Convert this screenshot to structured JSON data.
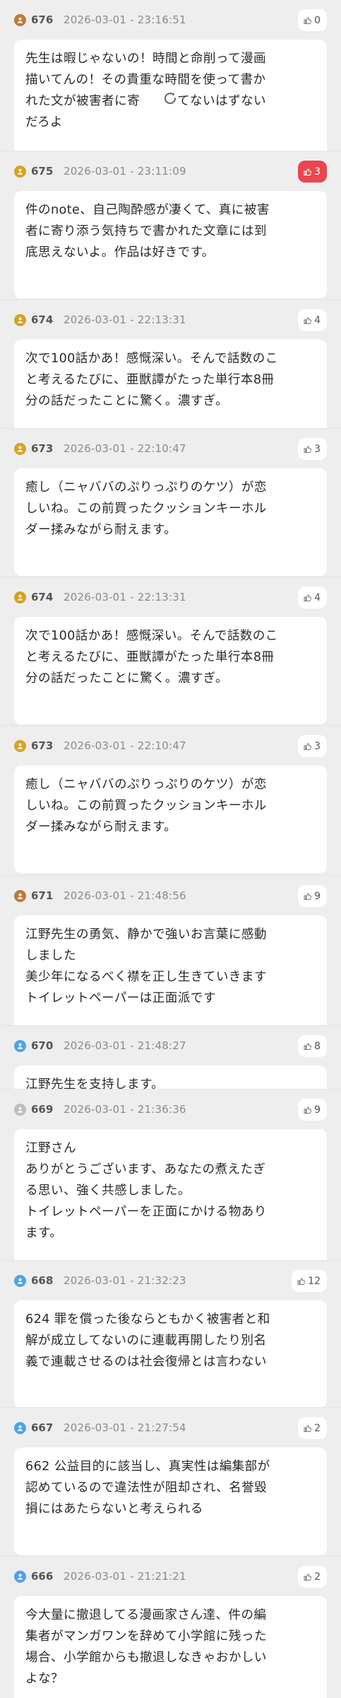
{
  "icons": {
    "avatar": "user-badge-icon",
    "like": "thumbs-up-icon",
    "loader": "loading-spinner-icon"
  },
  "colors": {
    "background": "#eeeeee",
    "card": "#ffffff",
    "like_active": "#e9474f",
    "avatar_gold": "#d7a21f",
    "avatar_bronze": "#c07a3a",
    "avatar_silver": "#bdbdbd",
    "avatar_blue": "#4fa3e8"
  },
  "posts": [
    {
      "number": "676",
      "time": "2026-03-01 - 23:16:51",
      "likes": "0",
      "liked": false,
      "avatar_color": "#c07a3a",
      "lines": [
        "先生は暇じゃないの！時間と命削って漫画",
        "描いてんの！その貴重な時間を使って書か",
        "れた文が被害者に寄　　ってないはずない",
        "だろよ"
      ]
    },
    {
      "number": "675",
      "time": "2026-03-01 - 23:11:09",
      "likes": "3",
      "liked": true,
      "avatar_color": "#d7a21f",
      "lines": [
        "件のnote、自己陶酔感が凄くて、真に被害",
        "者に寄り添う気持ちで書かれた文章には到",
        "底思えないよ。作品は好きです。"
      ]
    },
    {
      "number": "674",
      "time": "2026-03-01 - 22:13:31",
      "likes": "4",
      "liked": false,
      "avatar_color": "#d7a21f",
      "lines": [
        "次で100話かあ！感慨深い。そんで話数のこ",
        "と考えるたびに、亜獣譚がたった単行本8冊",
        "分の話だったことに驚く。濃すぎ。"
      ]
    },
    {
      "number": "673",
      "time": "2026-03-01 - 22:10:47",
      "likes": "3",
      "liked": false,
      "avatar_color": "#d7a21f",
      "lines": [
        "癒し（ニャババのぷりっぷりのケツ）が恋",
        "しいね。この前買ったクッションキーホル",
        "ダー揉みながら耐えます。"
      ]
    },
    {
      "number": "674",
      "time": "2026-03-01 - 22:13:31",
      "likes": "4",
      "liked": false,
      "avatar_color": "#d7a21f",
      "lines": [
        "次で100話かあ！感慨深い。そんで話数のこ",
        "と考えるたびに、亜獣譚がたった単行本8冊",
        "分の話だったことに驚く。濃すぎ。"
      ]
    },
    {
      "number": "673",
      "time": "2026-03-01 - 22:10:47",
      "likes": "3",
      "liked": false,
      "avatar_color": "#d7a21f",
      "lines": [
        "癒し（ニャババのぷりっぷりのケツ）が恋",
        "しいね。この前買ったクッションキーホル",
        "ダー揉みながら耐えます。"
      ]
    },
    {
      "number": "671",
      "time": "2026-03-01 - 21:48:56",
      "likes": "9",
      "liked": false,
      "avatar_color": "#c07a3a",
      "lines": [
        "江野先生の勇気、静かで強いお言葉に感動",
        "しました",
        "美少年になるべく襟を正し生きていきます",
        "トイレットペーパーは正面派です"
      ]
    },
    {
      "number": "670",
      "time": "2026-03-01 - 21:48:27",
      "likes": "8",
      "liked": false,
      "avatar_color": "#4fa3e8",
      "lines": [
        "江野先生を支持します。"
      ]
    },
    {
      "number": "669",
      "time": "2026-03-01 - 21:36:36",
      "likes": "9",
      "liked": false,
      "avatar_color": "#bdbdbd",
      "lines": [
        "江野さん",
        "ありがとうございます、あなたの煮えたぎ",
        "る思い、強く共感しました。",
        "トイレットペーパーを正面にかける物あり",
        "ます。"
      ]
    },
    {
      "number": "668",
      "time": "2026-03-01 - 21:32:23",
      "likes": "12",
      "liked": false,
      "avatar_color": "#4fa3e8",
      "lines": [
        "624 罪を償った後ならともかく被害者と和",
        "解が成立してないのに連載再開したり別名",
        "義で連載させるのは社会復帰とは言わない"
      ]
    },
    {
      "number": "667",
      "time": "2026-03-01 - 21:27:54",
      "likes": "2",
      "liked": false,
      "avatar_color": "#4fa3e8",
      "lines": [
        "662 公益目的に該当し、真実性は編集部が",
        "認めているので違法性が阻却され、名誉毀",
        "損にはあたらないと考えられる"
      ]
    },
    {
      "number": "666",
      "time": "2026-03-01 - 21:21:21",
      "likes": "2",
      "liked": false,
      "avatar_color": "#4fa3e8",
      "lines": [
        "今大量に撤退してる漫画家さん達、件の編",
        "集者がマンガワンを辞めて小学館に残った",
        "場合、小学館からも撤退しなきゃおかしい",
        "よな？"
      ]
    }
  ]
}
